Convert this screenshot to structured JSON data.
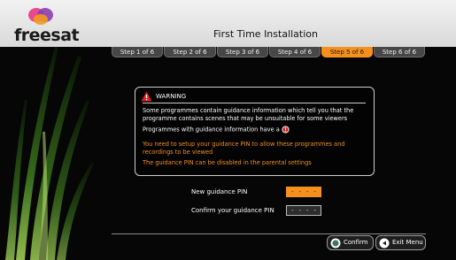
{
  "brand": {
    "name": "freesat"
  },
  "header": {
    "title": "First Time Installation"
  },
  "steps": [
    {
      "label": "Step 1 of 6",
      "active": false
    },
    {
      "label": "Step 2 of 6",
      "active": false
    },
    {
      "label": "Step 3 of 6",
      "active": false
    },
    {
      "label": "Step 4 of 6",
      "active": false
    },
    {
      "label": "Step 5 of 6",
      "active": true
    },
    {
      "label": "Step 6 of 6",
      "active": false
    }
  ],
  "warning": {
    "title": "WARNING",
    "text1": "Some programmes contain guidance information which tell you that the programme contains scenes that may be unsuitable for some viewers",
    "text2": "Programmes with guidance information have a",
    "text3": "You need to setup your guidance PIN to allow these programmes and recordings to be viewed",
    "text4": "The guidance PIN can be disabled in the parental settings"
  },
  "pin": {
    "new_label": "New guidance PIN",
    "new_value": "- - - -",
    "confirm_label": "Confirm your guidance PIN",
    "confirm_value": "- - - -"
  },
  "buttons": {
    "confirm": "Confirm",
    "exit": "Exit Menu"
  },
  "colors": {
    "accent": "#f5901d",
    "background": "#000000",
    "header": "#e6e6e6"
  },
  "icons": [
    "freesat-logo",
    "warning-triangle-icon",
    "guidance-g-icon",
    "ok-button-icon",
    "back-button-icon"
  ]
}
